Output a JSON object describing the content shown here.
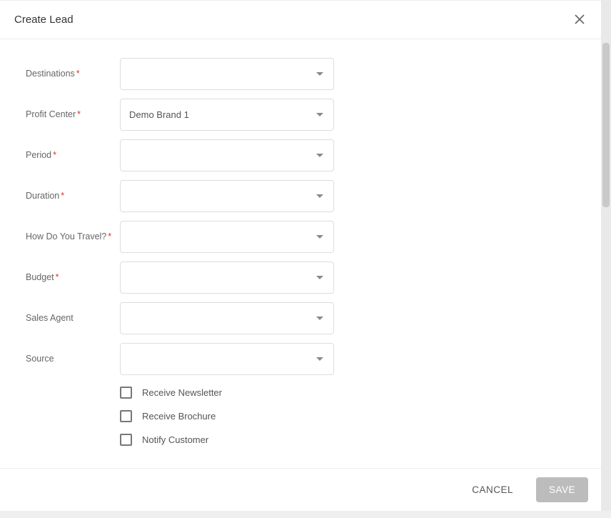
{
  "modal": {
    "title": "Create Lead",
    "closeIcon": "close-icon"
  },
  "fields": {
    "destinations": {
      "label": "Destinations",
      "required": true,
      "value": ""
    },
    "profitCenter": {
      "label": "Profit Center",
      "required": true,
      "value": "Demo Brand 1"
    },
    "period": {
      "label": "Period",
      "required": true,
      "value": ""
    },
    "duration": {
      "label": "Duration",
      "required": true,
      "value": ""
    },
    "howTravel": {
      "label": "How Do You Travel?",
      "required": true,
      "value": ""
    },
    "budget": {
      "label": "Budget",
      "required": true,
      "value": ""
    },
    "salesAgent": {
      "label": "Sales Agent",
      "required": false,
      "value": ""
    },
    "source": {
      "label": "Source",
      "required": false,
      "value": ""
    }
  },
  "checkboxes": {
    "newsletter": {
      "label": "Receive Newsletter",
      "checked": false
    },
    "brochure": {
      "label": "Receive Brochure",
      "checked": false
    },
    "notify": {
      "label": "Notify Customer",
      "checked": false
    }
  },
  "footer": {
    "cancel": "CANCEL",
    "save": "SAVE"
  }
}
